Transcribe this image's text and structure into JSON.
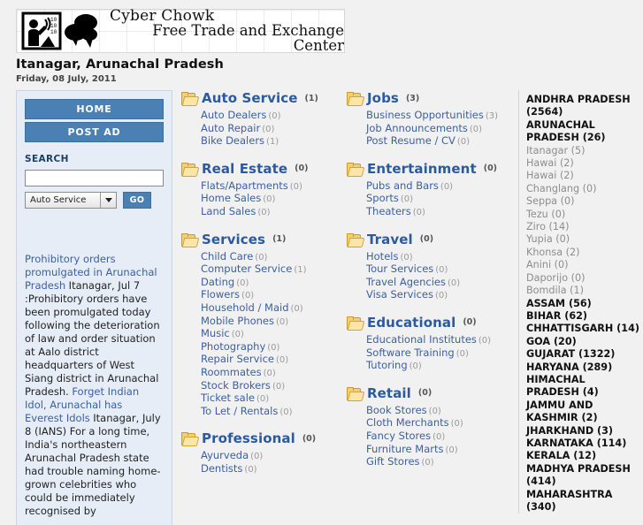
{
  "header": {
    "brand_line1": "Cyber Chowk",
    "brand_line2": "Free Trade and Exchange Center",
    "location": "Itanagar, Arunachal Pradesh",
    "date": "Friday, 08 July, 2011"
  },
  "sidebar": {
    "home_label": "HOME",
    "post_ad_label": "POST AD",
    "search_label": "SEARCH",
    "search_value": "",
    "search_placeholder": "",
    "category_select_value": "Auto Service",
    "go_label": "GO",
    "news": [
      {
        "title": "Prohibitory orders promulgated in Arunachal Pradesh",
        "body": "Itanagar, Jul 7 :Prohibitory orders have been promulgated today following the deterioration of law and order situation at Aalo district headquarters of West Siang district in Arunachal Pradesh."
      },
      {
        "title": "Forget Indian Idol, Arunachal has Everest Idols",
        "body": "Itanagar, July 8 (IANS) For a long time, India's northeastern Arunachal Pradesh state had trouble naming home-grown celebrities who could be immediately recognised by"
      }
    ]
  },
  "categories": {
    "column1": [
      {
        "title": "Auto Service",
        "count": "(1)",
        "subs": [
          {
            "name": "Auto Dealers",
            "count": "(0)"
          },
          {
            "name": "Auto Repair",
            "count": "(0)"
          },
          {
            "name": "Bike Dealers",
            "count": "(1)"
          }
        ]
      },
      {
        "title": "Real Estate",
        "count": "(0)",
        "subs": [
          {
            "name": "Flats/Apartments",
            "count": "(0)"
          },
          {
            "name": "Home Sales",
            "count": "(0)"
          },
          {
            "name": "Land Sales",
            "count": "(0)"
          }
        ]
      },
      {
        "title": "Services",
        "count": "(1)",
        "subs": [
          {
            "name": "Child Care",
            "count": "(0)"
          },
          {
            "name": "Computer Service",
            "count": "(1)"
          },
          {
            "name": "Dating",
            "count": "(0)"
          },
          {
            "name": "Flowers",
            "count": "(0)"
          },
          {
            "name": "Household / Maid",
            "count": "(0)"
          },
          {
            "name": "Mobile Phones",
            "count": "(0)"
          },
          {
            "name": "Music",
            "count": "(0)"
          },
          {
            "name": "Photography",
            "count": "(0)"
          },
          {
            "name": "Repair Service",
            "count": "(0)"
          },
          {
            "name": "Roommates",
            "count": "(0)"
          },
          {
            "name": "Stock Brokers",
            "count": "(0)"
          },
          {
            "name": "Ticket sale",
            "count": "(0)"
          },
          {
            "name": "To Let / Rentals",
            "count": "(0)"
          }
        ]
      },
      {
        "title": "Professional",
        "count": "(0)",
        "subs": [
          {
            "name": "Ayurveda",
            "count": "(0)"
          },
          {
            "name": "Dentists",
            "count": "(0)"
          }
        ]
      }
    ],
    "column2": [
      {
        "title": "Jobs",
        "count": "(3)",
        "subs": [
          {
            "name": "Business Opportunities",
            "count": "(3)"
          },
          {
            "name": "Job Announcements",
            "count": "(0)"
          },
          {
            "name": "Post Resume / CV",
            "count": "(0)"
          }
        ]
      },
      {
        "title": "Entertainment",
        "count": "(0)",
        "subs": [
          {
            "name": "Pubs and Bars",
            "count": "(0)"
          },
          {
            "name": "Sports",
            "count": "(0)"
          },
          {
            "name": "Theaters",
            "count": "(0)"
          }
        ]
      },
      {
        "title": "Travel",
        "count": "(0)",
        "subs": [
          {
            "name": "Hotels",
            "count": "(0)"
          },
          {
            "name": "Tour Services",
            "count": "(0)"
          },
          {
            "name": "Travel Agencies",
            "count": "(0)"
          },
          {
            "name": "Visa Services",
            "count": "(0)"
          }
        ]
      },
      {
        "title": "Educational",
        "count": "(0)",
        "subs": [
          {
            "name": "Educational Institutes",
            "count": "(0)"
          },
          {
            "name": "Software Training",
            "count": "(0)"
          },
          {
            "name": "Tutoring",
            "count": "(0)"
          }
        ]
      },
      {
        "title": "Retail",
        "count": "(0)",
        "subs": [
          {
            "name": "Book Stores",
            "count": "(0)"
          },
          {
            "name": "Cloth Merchants",
            "count": "(0)"
          },
          {
            "name": "Fancy Stores",
            "count": "(0)"
          },
          {
            "name": "Furniture Marts",
            "count": "(0)"
          },
          {
            "name": "Gift Stores",
            "count": "(0)"
          }
        ]
      }
    ]
  },
  "locations": [
    {
      "type": "state",
      "label": "ANDHRA PRADESH (2564)"
    },
    {
      "type": "state",
      "label": "ARUNACHAL PRADESH (26)"
    },
    {
      "type": "city",
      "label": "Itanagar (5)"
    },
    {
      "type": "city",
      "label": "Hawai (2)"
    },
    {
      "type": "city",
      "label": "Hawai (2)"
    },
    {
      "type": "city",
      "label": "Changlang (0)"
    },
    {
      "type": "city",
      "label": "Seppa (0)"
    },
    {
      "type": "city",
      "label": "Tezu (0)"
    },
    {
      "type": "city",
      "label": "Ziro (14)"
    },
    {
      "type": "city",
      "label": "Yupia (0)"
    },
    {
      "type": "city",
      "label": "Khonsa (2)"
    },
    {
      "type": "city",
      "label": "Anini (0)"
    },
    {
      "type": "city",
      "label": "Daporijo (0)"
    },
    {
      "type": "city",
      "label": "Bomdila (1)"
    },
    {
      "type": "state",
      "label": "ASSAM (56)"
    },
    {
      "type": "state",
      "label": "BIHAR (62)"
    },
    {
      "type": "state",
      "label": "CHHATTISGARH (14)"
    },
    {
      "type": "state",
      "label": "GOA (20)"
    },
    {
      "type": "state",
      "label": "GUJARAT (1322)"
    },
    {
      "type": "state",
      "label": "HARYANA (289)"
    },
    {
      "type": "state",
      "label": "HIMACHAL PRADESH (4)"
    },
    {
      "type": "state",
      "label": "JAMMU AND KASHMIR (2)"
    },
    {
      "type": "state",
      "label": "JHARKHAND (3)"
    },
    {
      "type": "state",
      "label": "KARNATAKA (114)"
    },
    {
      "type": "state",
      "label": "KERALA (12)"
    },
    {
      "type": "state",
      "label": "MADHYA PRADESH (414)"
    },
    {
      "type": "state",
      "label": "MAHARASHTRA (340)"
    }
  ],
  "colors": {
    "accent_blue": "#4a80b4",
    "link_blue": "#3b5fa0",
    "heading_blue": "#2c5aa0",
    "sidebar_bg": "#e6edf7",
    "page_bg": "#f1f1f1",
    "folder_yellow": "#f3cf72"
  }
}
